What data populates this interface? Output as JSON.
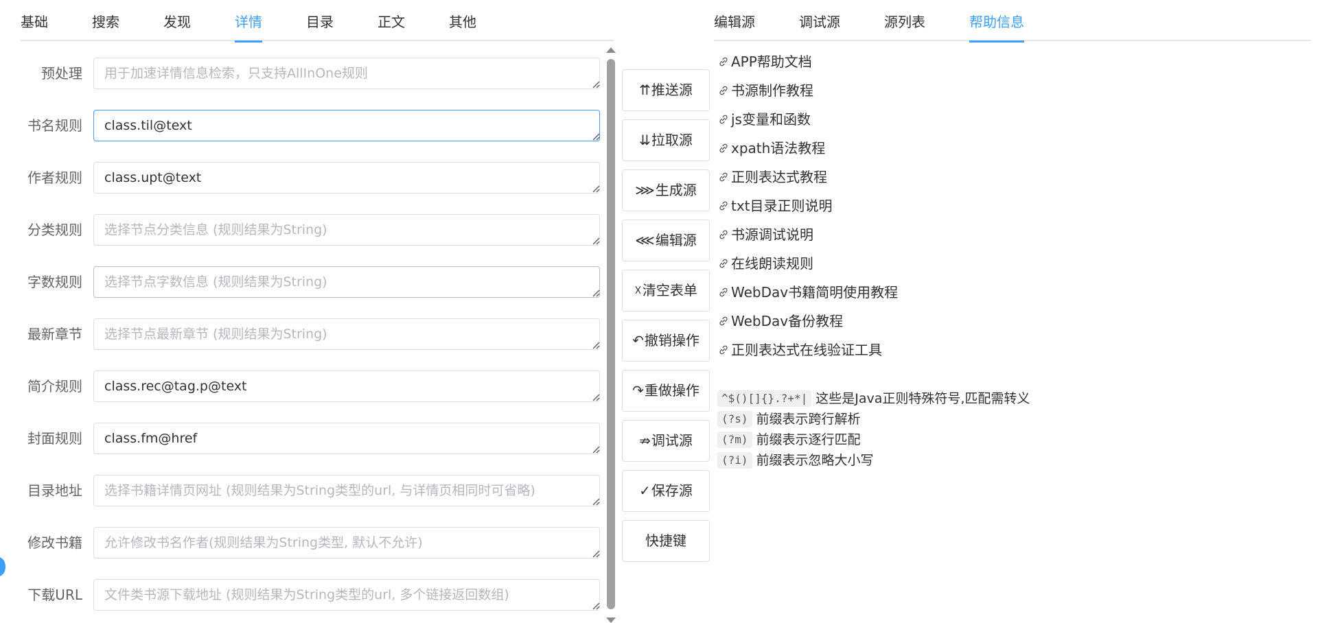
{
  "left_tabs": [
    {
      "label": "基础",
      "active": false
    },
    {
      "label": "搜索",
      "active": false
    },
    {
      "label": "发现",
      "active": false
    },
    {
      "label": "详情",
      "active": true
    },
    {
      "label": "目录",
      "active": false
    },
    {
      "label": "正文",
      "active": false
    },
    {
      "label": "其他",
      "active": false
    }
  ],
  "form": {
    "rows": [
      {
        "label": "预处理",
        "value": "",
        "placeholder": "用于加速详情信息检索，只支持AllInOne规则"
      },
      {
        "label": "书名规则",
        "value": "class.til@text",
        "placeholder": ""
      },
      {
        "label": "作者规则",
        "value": "class.upt@text",
        "placeholder": ""
      },
      {
        "label": "分类规则",
        "value": "",
        "placeholder": "选择节点分类信息 (规则结果为String)"
      },
      {
        "label": "字数规则",
        "value": "",
        "placeholder": "选择节点字数信息 (规则结果为String)"
      },
      {
        "label": "最新章节",
        "value": "",
        "placeholder": "选择节点最新章节 (规则结果为String)"
      },
      {
        "label": "简介规则",
        "value": "class.rec@tag.p@text",
        "placeholder": ""
      },
      {
        "label": "封面规则",
        "value": "class.fm@href",
        "placeholder": ""
      },
      {
        "label": "目录地址",
        "value": "",
        "placeholder": "选择书籍详情页网址 (规则结果为String类型的url, 与详情页相同时可省略)"
      },
      {
        "label": "修改书籍",
        "value": "",
        "placeholder": "允许修改书名作者(规则结果为String类型, 默认不允许)"
      },
      {
        "label": "下载URL",
        "value": "",
        "placeholder": "文件类书源下载地址 (规则结果为String类型的url, 多个链接返回数组)"
      }
    ]
  },
  "buttons": [
    {
      "icon": "⇈",
      "label": "推送源"
    },
    {
      "icon": "⇊",
      "label": "拉取源"
    },
    {
      "icon": "⋙",
      "label": "生成源"
    },
    {
      "icon": "⋘",
      "label": "编辑源"
    },
    {
      "icon": "☓",
      "label": "清空表单"
    },
    {
      "icon": "↶",
      "label": "撤销操作"
    },
    {
      "icon": "↷",
      "label": "重做操作"
    },
    {
      "icon": "⇏",
      "label": "调试源"
    },
    {
      "icon": "✓",
      "label": "保存源"
    },
    {
      "icon": "",
      "label": "快捷键"
    }
  ],
  "right_tabs": [
    {
      "label": "编辑源",
      "active": false
    },
    {
      "label": "调试源",
      "active": false
    },
    {
      "label": "源列表",
      "active": false
    },
    {
      "label": "帮助信息",
      "active": true
    }
  ],
  "help_links": [
    "APP帮助文档",
    "书源制作教程",
    "js变量和函数",
    "xpath语法教程",
    "正则表达式教程",
    "txt目录正则说明",
    "书源调试说明",
    "在线朗读规则",
    "WebDav书籍简明使用教程",
    "WebDav备份教程",
    "正则表达式在线验证工具"
  ],
  "regex_notes": [
    {
      "code": "^$()[]{}.?+*|",
      "text": "这些是Java正则特殊符号,匹配需转义"
    },
    {
      "code": "(?s)",
      "text": "前缀表示跨行解析"
    },
    {
      "code": "(?m)",
      "text": "前缀表示逐行匹配"
    },
    {
      "code": "(?i)",
      "text": "前缀表示忽略大小写"
    }
  ],
  "colors": {
    "accent": "#409eff",
    "text": "#303133",
    "label": "#606266",
    "border": "#dcdfe6",
    "placeholder": "#b4b7be"
  },
  "icons": {
    "link": "link-icon",
    "resize": "resize-grip-icon"
  }
}
